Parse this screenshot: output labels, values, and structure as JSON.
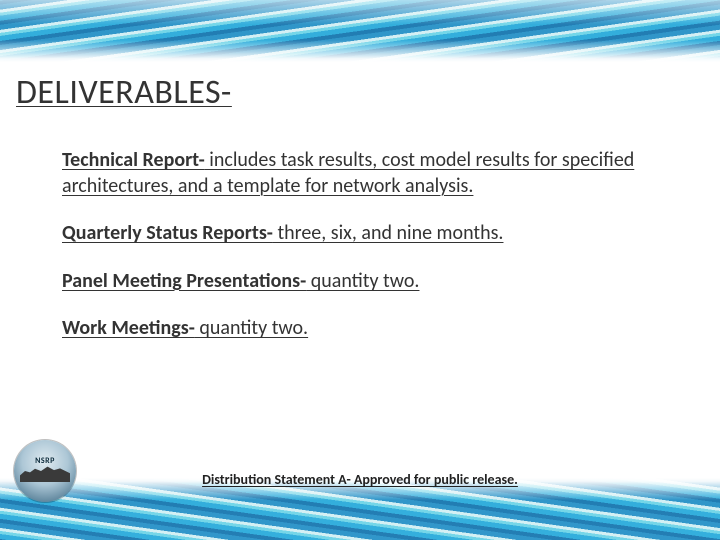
{
  "title": "DELIVERABLES-",
  "items": [
    {
      "lead": "Technical Report-",
      "rest": " includes task results, cost model results for specified architectures, and a template for network analysis."
    },
    {
      "lead": "Quarterly Status Reports-",
      "rest": " three, six, and nine months."
    },
    {
      "lead": "Panel Meeting Presentations-",
      "rest": " quantity two."
    },
    {
      "lead": "Work Meetings-",
      "rest": " quantity two."
    }
  ],
  "logo": {
    "label": "NSRP"
  },
  "footer": "Distribution Statement A- Approved for public release."
}
